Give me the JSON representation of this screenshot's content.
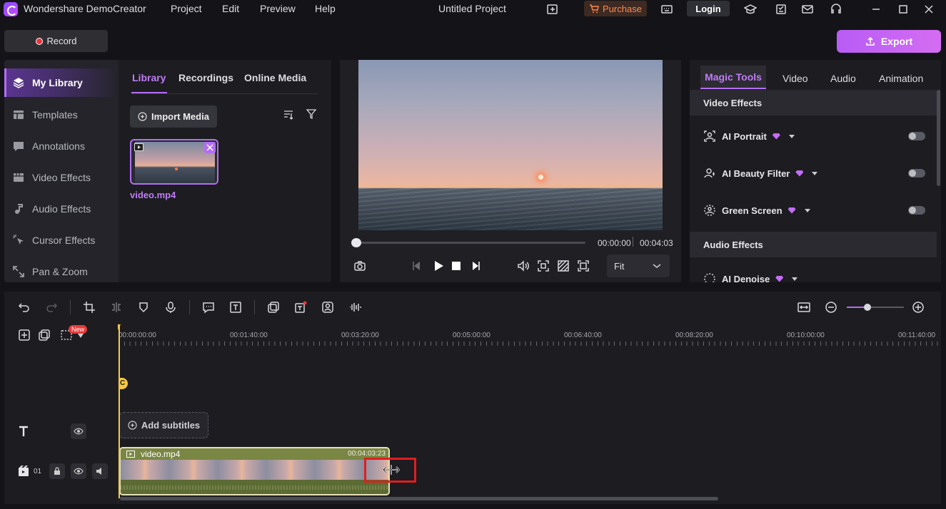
{
  "app": {
    "title": "Wondershare DemoCreator",
    "project_title": "Untitled Project",
    "menu": [
      "Project",
      "Edit",
      "Preview",
      "Help"
    ],
    "purchase_label": "Purchase",
    "login_label": "Login"
  },
  "toolbar": {
    "record_label": "Record",
    "export_label": "Export"
  },
  "sidebar": {
    "items": [
      {
        "label": "My Library",
        "icon": "layers-icon",
        "active": true
      },
      {
        "label": "Templates",
        "icon": "template-icon"
      },
      {
        "label": "Annotations",
        "icon": "annotation-icon"
      },
      {
        "label": "Video Effects",
        "icon": "video-effects-icon"
      },
      {
        "label": "Audio Effects",
        "icon": "music-note-icon"
      },
      {
        "label": "Cursor Effects",
        "icon": "cursor-icon"
      },
      {
        "label": "Pan & Zoom",
        "icon": "pan-zoom-icon"
      }
    ]
  },
  "library": {
    "tabs": [
      "Library",
      "Recordings",
      "Online Media"
    ],
    "import_label": "Import Media",
    "media": [
      {
        "name": "video.mp4"
      }
    ]
  },
  "preview": {
    "current_time": "00:00:00",
    "total_time": "00:04:03",
    "fit_label": "Fit"
  },
  "right_panel": {
    "tabs": [
      "Magic Tools",
      "Video",
      "Audio",
      "Animation"
    ],
    "video_effects_header": "Video Effects",
    "effects": [
      {
        "label": "AI Portrait",
        "enabled": false
      },
      {
        "label": "AI Beauty Filter",
        "enabled": false
      },
      {
        "label": "Green Screen",
        "enabled": false
      }
    ],
    "audio_effects_header": "Audio Effects",
    "audio_effects": [
      {
        "label": "AI Denoise"
      }
    ]
  },
  "timeline": {
    "ruler_labels": [
      "00:00:00:00",
      "00:01:40:00",
      "00:03:20:00",
      "00:05:00:00",
      "00:06:40:00",
      "00:08:20:00",
      "00:10:00:00",
      "00:11:40:00"
    ],
    "new_badge": "New",
    "marker_label": "C",
    "add_subtitles_label": "Add subtitles",
    "track_number": "01",
    "clip": {
      "name": "video.mp4",
      "duration": "00:04:03:23"
    }
  },
  "colors": {
    "accent": "#b36ef5",
    "export_gradient": [
      "#b85cf5",
      "#d46df2"
    ],
    "clip": "#6d7a3e",
    "playhead": "#f5c842",
    "highlight": "#e01e1e"
  }
}
